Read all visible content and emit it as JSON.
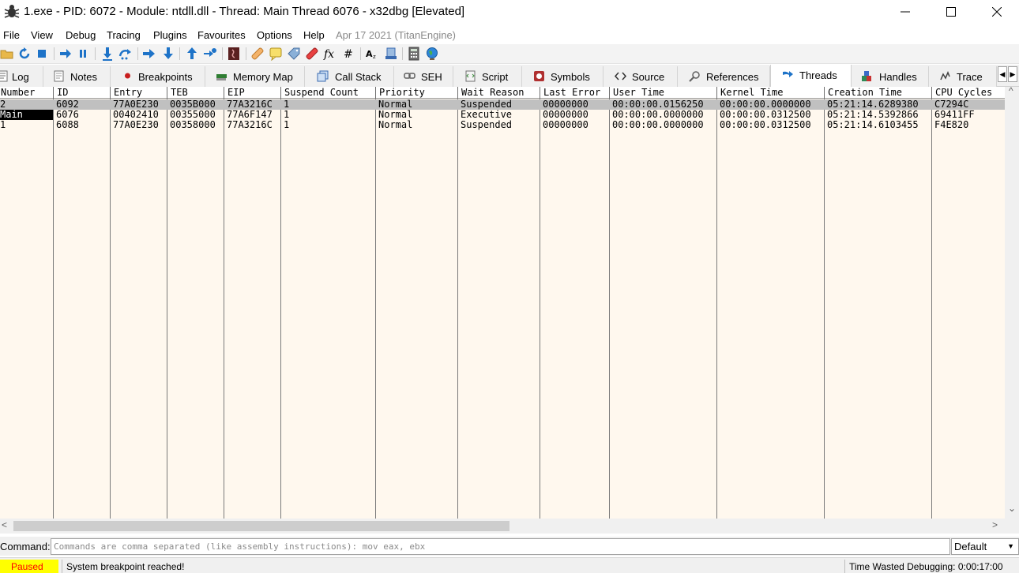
{
  "window": {
    "title": "1.exe - PID: 6072 - Module: ntdll.dll - Thread: Main Thread 6076 - x32dbg [Elevated]",
    "icons": {
      "app": "bug-icon",
      "minimize": "minimize-icon",
      "maximize": "maximize-icon",
      "close": "close-icon"
    }
  },
  "menu": {
    "items": [
      "File",
      "View",
      "Debug",
      "Tracing",
      "Plugins",
      "Favourites",
      "Options",
      "Help"
    ],
    "version": "Apr 17 2021 (TitanEngine)"
  },
  "toolbar": {
    "icons": [
      "open-icon",
      "restart-icon",
      "stop-icon",
      "run-icon",
      "pause-icon",
      "step-into-icon",
      "step-over-icon",
      "trace-into-icon",
      "trace-over-icon",
      "execute-till-return-icon",
      "run-to-user-code-icon",
      "scylla-icon",
      "patch-icon",
      "comment-icon",
      "label-icon",
      "bookmark-icon",
      "function-icon",
      "hash-icon",
      "font-icon",
      "module-icon",
      "calculator-icon",
      "globe-icon"
    ]
  },
  "tabs": [
    {
      "label": "Log",
      "icon": "log-icon"
    },
    {
      "label": "Notes",
      "icon": "notes-icon"
    },
    {
      "label": "Breakpoints",
      "icon": "breakpoint-dot-icon"
    },
    {
      "label": "Memory Map",
      "icon": "memory-chip-icon"
    },
    {
      "label": "Call Stack",
      "icon": "call-stack-icon"
    },
    {
      "label": "SEH",
      "icon": "seh-chain-icon"
    },
    {
      "label": "Script",
      "icon": "script-icon"
    },
    {
      "label": "Symbols",
      "icon": "symbols-icon"
    },
    {
      "label": "Source",
      "icon": "source-code-icon"
    },
    {
      "label": "References",
      "icon": "search-icon"
    },
    {
      "label": "Threads",
      "icon": "threads-arrow-icon",
      "active": true
    },
    {
      "label": "Handles",
      "icon": "handles-blocks-icon"
    },
    {
      "label": "Trace",
      "icon": "trace-icon"
    }
  ],
  "threads_table": {
    "columns": [
      "Number",
      "ID",
      "Entry",
      "TEB",
      "EIP",
      "Suspend Count",
      "Priority",
      "Wait Reason",
      "Last Error",
      "User Time",
      "Kernel Time",
      "Creation Time",
      "CPU Cycles"
    ],
    "rows": [
      {
        "selected": true,
        "cells": [
          "2",
          "6092",
          "77A0E230",
          "0035B000",
          "77A3216C",
          "1",
          "Normal",
          "Suspended",
          "00000000",
          "00:00:00.0156250",
          "00:00:00.0000000",
          "05:21:14.6289380",
          "C7294C"
        ]
      },
      {
        "selected": false,
        "highlight_first": true,
        "cells": [
          "Main",
          "6076",
          "00402410",
          "00355000",
          "77A6F147",
          "1",
          "Normal",
          "Executive",
          "00000000",
          "00:00:00.0000000",
          "00:00:00.0312500",
          "05:21:14.5392866",
          "69411FF"
        ]
      },
      {
        "selected": false,
        "cells": [
          "1",
          "6088",
          "77A0E230",
          "00358000",
          "77A3216C",
          "1",
          "Normal",
          "Suspended",
          "00000000",
          "00:00:00.0000000",
          "00:00:00.0312500",
          "05:21:14.6103455",
          "F4E820"
        ]
      }
    ]
  },
  "command": {
    "label": "Command:",
    "placeholder": "Commands are comma separated (like assembly instructions): mov eax, ebx",
    "mode": "Default"
  },
  "status": {
    "state": "Paused",
    "message": "System breakpoint reached!",
    "time_wasted": "Time Wasted Debugging: 0:00:17:00"
  },
  "colors": {
    "table_bg": "#fff8ee",
    "selected_row": "#c0c0c0",
    "paused_bg": "#ffff00",
    "paused_text": "#ff0000",
    "tab_icon_blue": "#1e73c8"
  }
}
